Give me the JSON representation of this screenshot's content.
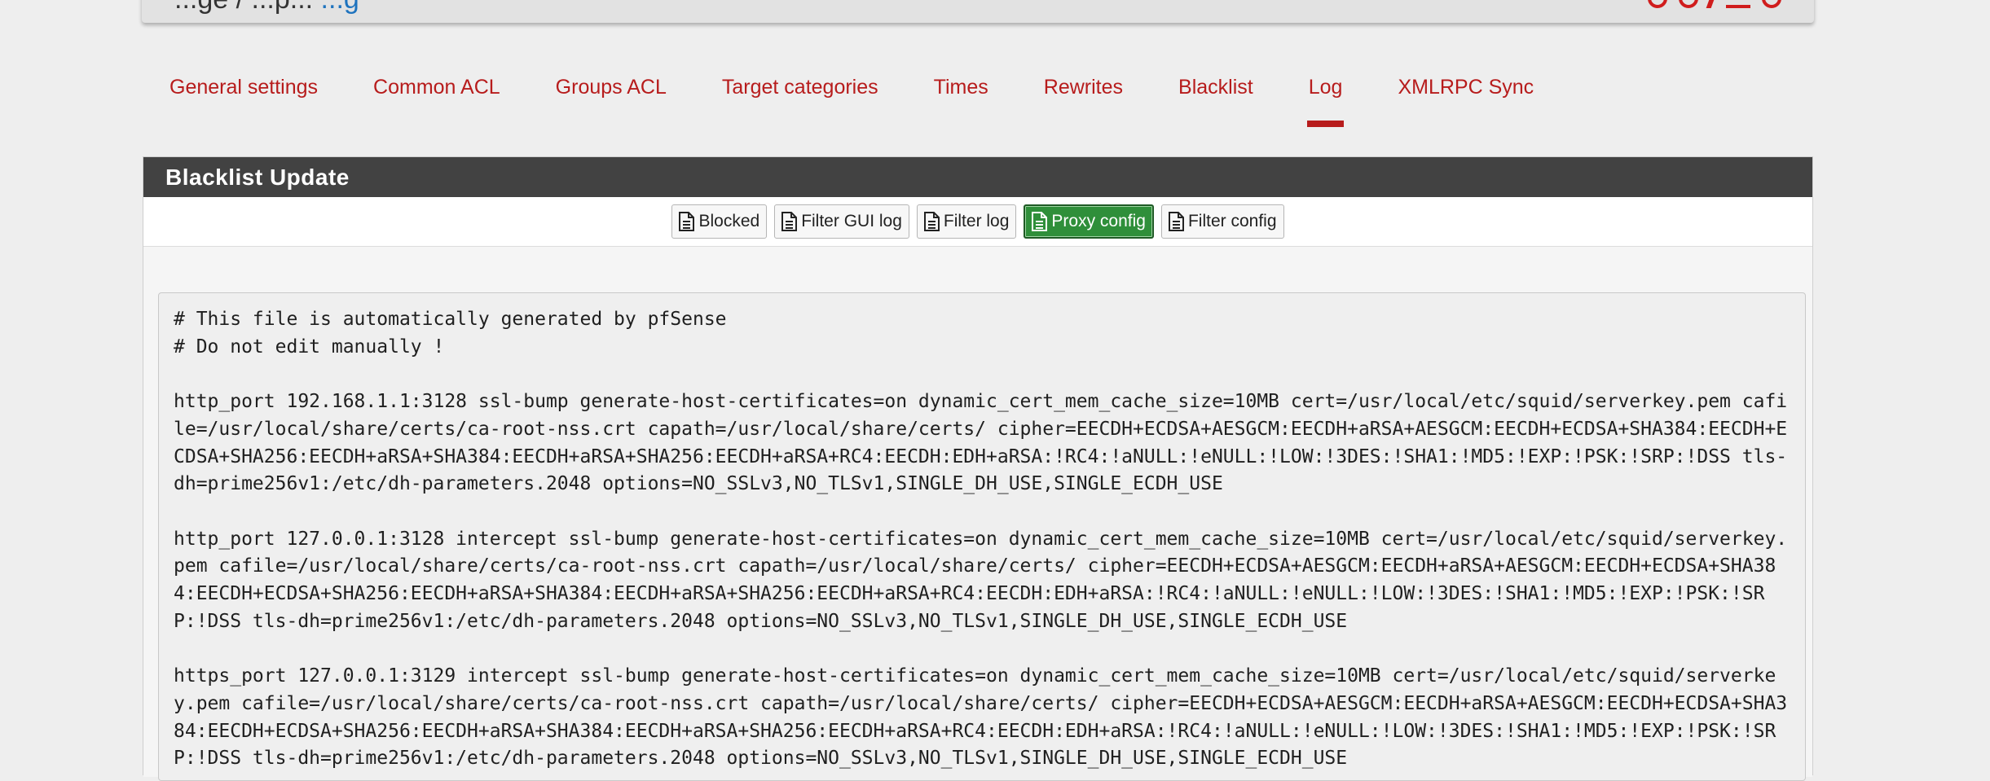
{
  "header": {
    "crumb_text": "...ge / ...p...",
    "crumb_link": "...g"
  },
  "tabs": [
    {
      "label": "General settings",
      "active": false
    },
    {
      "label": "Common ACL",
      "active": false
    },
    {
      "label": "Groups ACL",
      "active": false
    },
    {
      "label": "Target categories",
      "active": false
    },
    {
      "label": "Times",
      "active": false
    },
    {
      "label": "Rewrites",
      "active": false
    },
    {
      "label": "Blacklist",
      "active": false
    },
    {
      "label": "Log",
      "active": true
    },
    {
      "label": "XMLRPC Sync",
      "active": false
    }
  ],
  "panel": {
    "title": "Blacklist Update",
    "buttons": [
      {
        "label": "Blocked",
        "icon": "file-text-icon",
        "active": false
      },
      {
        "label": "Filter GUI log",
        "icon": "file-text-icon",
        "active": false
      },
      {
        "label": "Filter log",
        "icon": "file-text-icon",
        "active": false
      },
      {
        "label": "Proxy config",
        "icon": "file-text-icon",
        "active": true
      },
      {
        "label": "Filter config",
        "icon": "file-text-icon",
        "active": false
      }
    ]
  },
  "log_lines": [
    "# This file is automatically generated by pfSense",
    "# Do not edit manually !",
    "",
    "http_port 192.168.1.1:3128 ssl-bump generate-host-certificates=on dynamic_cert_mem_cache_size=10MB cert=/usr/local/etc/squid/serverkey.pem cafile=/usr/local/share/certs/ca-root-nss.crt capath=/usr/local/share/certs/ cipher=EECDH+ECDSA+AESGCM:EECDH+aRSA+AESGCM:EECDH+ECDSA+SHA384:EECDH+ECDSA+SHA256:EECDH+aRSA+SHA384:EECDH+aRSA+SHA256:EECDH+aRSA+RC4:EECDH:EDH+aRSA:!RC4:!aNULL:!eNULL:!LOW:!3DES:!SHA1:!MD5:!EXP:!PSK:!SRP:!DSS tls-dh=prime256v1:/etc/dh-parameters.2048 options=NO_SSLv3,NO_TLSv1,SINGLE_DH_USE,SINGLE_ECDH_USE",
    "",
    "http_port 127.0.0.1:3128 intercept ssl-bump generate-host-certificates=on dynamic_cert_mem_cache_size=10MB cert=/usr/local/etc/squid/serverkey.pem cafile=/usr/local/share/certs/ca-root-nss.crt capath=/usr/local/share/certs/ cipher=EECDH+ECDSA+AESGCM:EECDH+aRSA+AESGCM:EECDH+ECDSA+SHA384:EECDH+ECDSA+SHA256:EECDH+aRSA+SHA384:EECDH+aRSA+SHA256:EECDH+aRSA+RC4:EECDH:EDH+aRSA:!RC4:!aNULL:!eNULL:!LOW:!3DES:!SHA1:!MD5:!EXP:!PSK:!SRP:!DSS tls-dh=prime256v1:/etc/dh-parameters.2048 options=NO_SSLv3,NO_TLSv1,SINGLE_DH_USE,SINGLE_ECDH_USE",
    "",
    "https_port 127.0.0.1:3129 intercept ssl-bump generate-host-certificates=on dynamic_cert_mem_cache_size=10MB cert=/usr/local/etc/squid/serverkey.pem cafile=/usr/local/share/certs/ca-root-nss.crt capath=/usr/local/share/certs/ cipher=EECDH+ECDSA+AESGCM:EECDH+aRSA+AESGCM:EECDH+ECDSA+SHA384:EECDH+ECDSA+SHA256:EECDH+aRSA+SHA384:EECDH+aRSA+SHA256:EECDH+aRSA+RC4:EECDH:EDH+aRSA:!RC4:!aNULL:!eNULL:!LOW:!3DES:!SHA1:!MD5:!EXP:!PSK:!SRP:!DSS tls-dh=prime256v1:/etc/dh-parameters.2048 options=NO_SSLv3,NO_TLSv1,SINGLE_DH_USE,SINGLE_ECDH_USE"
  ],
  "colors": {
    "accent_red": "#b71c1c",
    "active_green": "#2f8f3a",
    "heading_bg": "#424242",
    "icon_red": "#d01d1d"
  }
}
